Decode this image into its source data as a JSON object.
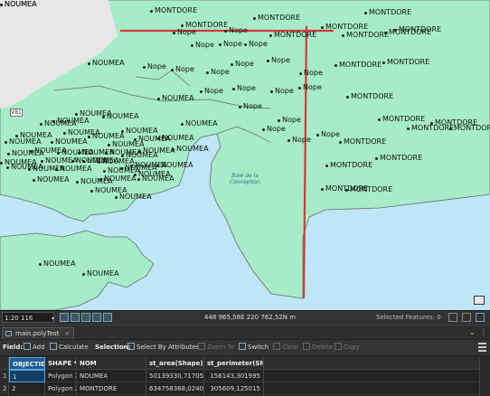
{
  "map": {
    "bay_label": "Baie de la Conception",
    "road_shield": "V81",
    "grid_icon": "attribute-table-icon",
    "colors": {
      "land": "#a6ecc8",
      "water": "#bfe6f6",
      "basemap_land": "#e6e6e6",
      "boundary": "#d23a3a",
      "outline": "#6b6b6b"
    },
    "labels": [
      {
        "t": "MONTDORE"
      },
      {
        "t": "MONTDORE"
      },
      {
        "t": "MONTDORE"
      },
      {
        "t": "MONTDORE"
      },
      {
        "t": "MONTDORE"
      },
      {
        "t": "Nope"
      },
      {
        "t": "Nope"
      },
      {
        "t": "MONTDORE"
      },
      {
        "t": "MONTDORE"
      },
      {
        "t": "MONTDORE"
      },
      {
        "t": "Nope"
      },
      {
        "t": "Nope"
      },
      {
        "t": "Nope"
      },
      {
        "t": "Nope"
      },
      {
        "t": "Nope"
      },
      {
        "t": "Nope"
      },
      {
        "t": "Nope"
      },
      {
        "t": "MONTDORE"
      },
      {
        "t": "MONTDORE"
      },
      {
        "t": "Nope"
      },
      {
        "t": "Nope"
      },
      {
        "t": "Nope"
      },
      {
        "t": "Nope"
      },
      {
        "t": "Nope"
      },
      {
        "t": "Nope"
      },
      {
        "t": "Nope"
      },
      {
        "t": "MONTDORE"
      },
      {
        "t": "Nope"
      },
      {
        "t": "MONTDORE"
      },
      {
        "t": "MONTDORE"
      },
      {
        "t": "MONTDORE"
      },
      {
        "t": "MONTDORE"
      },
      {
        "t": "Nope"
      },
      {
        "t": "Nope"
      },
      {
        "t": "Nope"
      },
      {
        "t": "MONTDORE"
      },
      {
        "t": "MONTDORE"
      },
      {
        "t": "MONTDORE"
      },
      {
        "t": "MONTDORE"
      },
      {
        "t": "MONTDORE"
      },
      {
        "t": "MONTDORE"
      },
      {
        "t": "NOUMEA"
      },
      {
        "t": "NOUMEA"
      },
      {
        "t": "NOUMEA"
      },
      {
        "t": "NOUMEA"
      },
      {
        "t": "NOUMEA"
      },
      {
        "t": "NOUMEA"
      },
      {
        "t": "NOUMEA"
      },
      {
        "t": "NOUMEA"
      },
      {
        "t": "NOUMEA"
      },
      {
        "t": "NOUMEA"
      },
      {
        "t": "NOUMEA"
      },
      {
        "t": "NOUMEA"
      },
      {
        "t": "NOUMEA"
      },
      {
        "t": "NOUMEA"
      },
      {
        "t": "NOUMEA"
      },
      {
        "t": "NOUMEA"
      },
      {
        "t": "NOUMEA"
      },
      {
        "t": "NOUMEA"
      },
      {
        "t": "NOUMEA"
      },
      {
        "t": "NOUMEA"
      },
      {
        "t": "NOUMEA"
      },
      {
        "t": "NOUMEA"
      },
      {
        "t": "NOUMEA"
      },
      {
        "t": "NOUMEA"
      },
      {
        "t": "NOUMEA"
      },
      {
        "t": "NOUMEA"
      },
      {
        "t": "NOUMEA"
      },
      {
        "t": "NOUMEA"
      },
      {
        "t": "NOUMEA"
      },
      {
        "t": "NOUMEA"
      },
      {
        "t": "NOUMEA"
      },
      {
        "t": "NOUMEA"
      },
      {
        "t": "NOUMEA"
      },
      {
        "t": "NOUMEA"
      },
      {
        "t": "NOUMEA"
      },
      {
        "t": "NOUMEA"
      },
      {
        "t": "NOUMEA"
      },
      {
        "t": "NOUMEA"
      },
      {
        "t": "NOUMEA"
      },
      {
        "t": "NOUMEA"
      },
      {
        "t": "NOUMEA"
      },
      {
        "t": "NOUMEA"
      },
      {
        "t": "NOUMEA"
      },
      {
        "t": "NOUMEA"
      },
      {
        "t": "NOUMEA"
      },
      {
        "t": "NOUMEA"
      },
      {
        "t": "NOUMEA"
      }
    ]
  },
  "statusbar": {
    "scale": "1:20 116",
    "coords": "448 965,58E 220 762,52N m",
    "selected_features": "Selected Features: 0"
  },
  "table_tab": {
    "title": "main.polyTest",
    "close": "×"
  },
  "toolbar": {
    "field_label": "Field:",
    "add": "Add",
    "calculate": "Calculate",
    "selection_label": "Selection:",
    "select_by_attributes": "Select By Attributes",
    "zoom_to": "Zoom To",
    "switch": "Switch",
    "clear": "Clear",
    "delete": "Delete",
    "copy": "Copy"
  },
  "table": {
    "columns": [
      "OBJECTID *",
      "SHAPE *",
      "NOM",
      "st_area(Shape)",
      "st_perimeter(Shape)"
    ],
    "rows": [
      {
        "rownum": "1",
        "objectid": "1",
        "shape": "Polygon Z",
        "nom": "NOUMEA",
        "area": "50139330,717054",
        "perimeter": "156143,301995"
      },
      {
        "rownum": "2",
        "objectid": "2",
        "shape": "Polygon Z",
        "nom": "MONTDORE",
        "area": "634758368,02405",
        "perimeter": "305609,125015"
      }
    ]
  }
}
